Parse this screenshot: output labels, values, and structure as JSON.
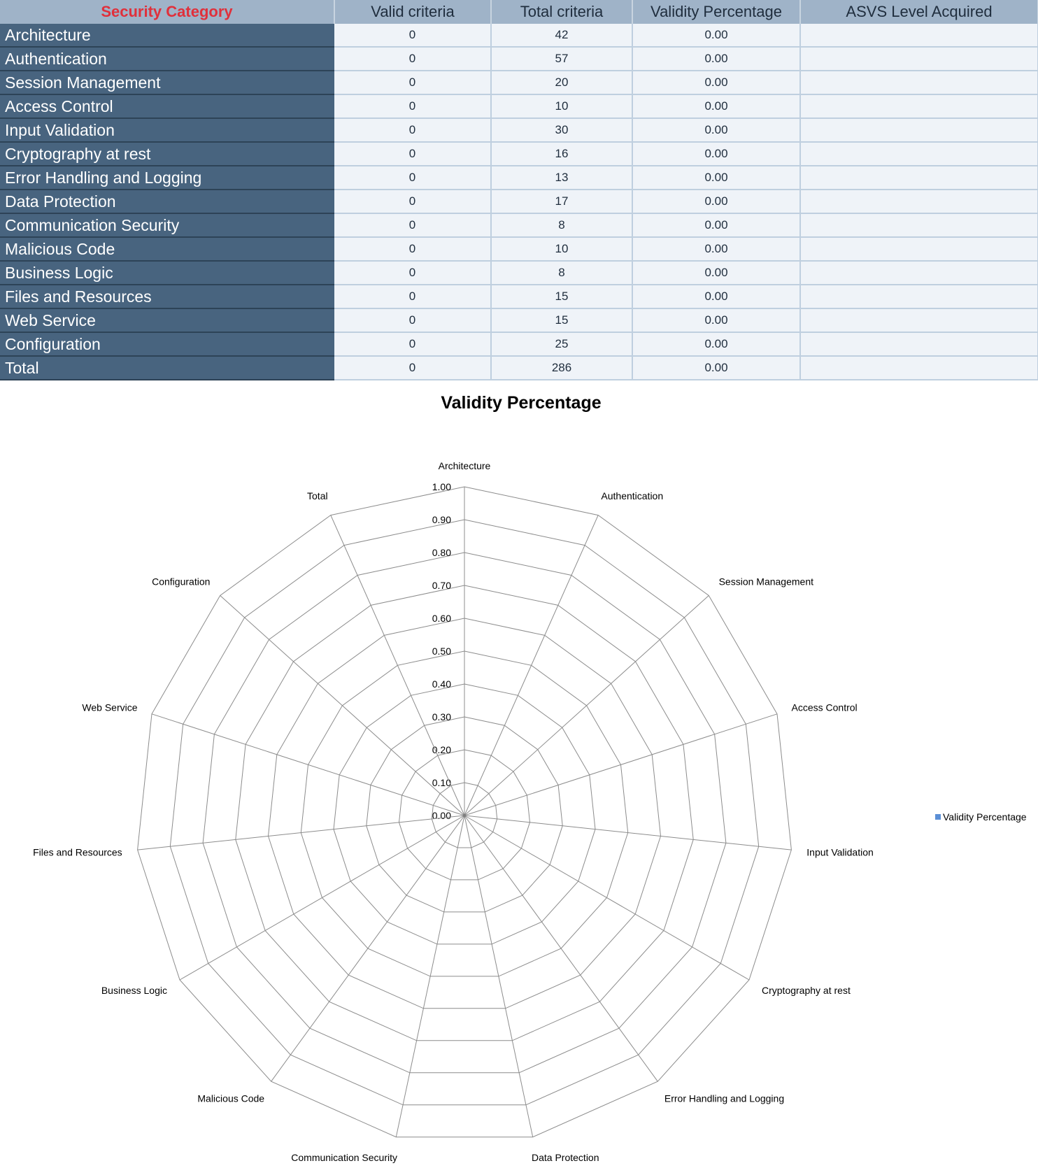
{
  "table": {
    "headers": [
      "Security Category",
      "Valid criteria",
      "Total criteria",
      "Validity Percentage",
      "ASVS Level Acquired"
    ],
    "rows": [
      {
        "category": "Architecture",
        "valid": "0",
        "total": "42",
        "pct": "0.00",
        "level": ""
      },
      {
        "category": "Authentication",
        "valid": "0",
        "total": "57",
        "pct": "0.00",
        "level": ""
      },
      {
        "category": "Session Management",
        "valid": "0",
        "total": "20",
        "pct": "0.00",
        "level": ""
      },
      {
        "category": "Access Control",
        "valid": "0",
        "total": "10",
        "pct": "0.00",
        "level": ""
      },
      {
        "category": "Input Validation",
        "valid": "0",
        "total": "30",
        "pct": "0.00",
        "level": ""
      },
      {
        "category": "Cryptography at rest",
        "valid": "0",
        "total": "16",
        "pct": "0.00",
        "level": ""
      },
      {
        "category": "Error Handling and Logging",
        "valid": "0",
        "total": "13",
        "pct": "0.00",
        "level": ""
      },
      {
        "category": "Data Protection",
        "valid": "0",
        "total": "17",
        "pct": "0.00",
        "level": ""
      },
      {
        "category": "Communication Security",
        "valid": "0",
        "total": "8",
        "pct": "0.00",
        "level": ""
      },
      {
        "category": "Malicious Code",
        "valid": "0",
        "total": "10",
        "pct": "0.00",
        "level": ""
      },
      {
        "category": "Business Logic",
        "valid": "0",
        "total": "8",
        "pct": "0.00",
        "level": ""
      },
      {
        "category": "Files and Resources",
        "valid": "0",
        "total": "15",
        "pct": "0.00",
        "level": ""
      },
      {
        "category": "Web Service",
        "valid": "0",
        "total": "15",
        "pct": "0.00",
        "level": ""
      },
      {
        "category": "Configuration",
        "valid": "0",
        "total": "25",
        "pct": "0.00",
        "level": ""
      },
      {
        "category": "Total",
        "valid": "0",
        "total": "286",
        "pct": "0.00",
        "level": ""
      }
    ]
  },
  "chart_data": {
    "type": "radar",
    "title": "Validity Percentage",
    "categories": [
      "Architecture",
      "Authentication",
      "Session Management",
      "Access Control",
      "Input Validation",
      "Cryptography at rest",
      "Error Handling and Logging",
      "Data Protection",
      "Communication Security",
      "Malicious Code",
      "Business Logic",
      "Files and Resources",
      "Web Service",
      "Configuration",
      "Total"
    ],
    "series": [
      {
        "name": "Validity Percentage",
        "values": [
          0,
          0,
          0,
          0,
          0,
          0,
          0,
          0,
          0,
          0,
          0,
          0,
          0,
          0,
          0
        ],
        "color": "#5b8fd6"
      }
    ],
    "rlim": [
      0,
      1
    ],
    "rticks": [
      "0.00",
      "0.10",
      "0.20",
      "0.30",
      "0.40",
      "0.50",
      "0.60",
      "0.70",
      "0.80",
      "0.90",
      "1.00"
    ],
    "grid": true,
    "legend_position": "right"
  }
}
